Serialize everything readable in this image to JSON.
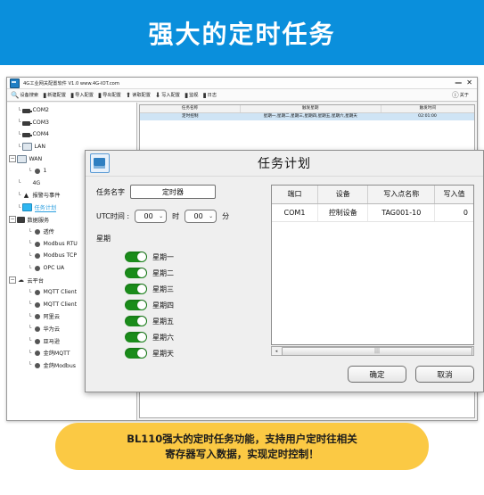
{
  "banner": {
    "title": "强大的定时任务"
  },
  "app": {
    "titlebar": {
      "icon": "app-icon",
      "title": "4G工业网关配置软件 V1.0 www.4G-IOT.com",
      "minimize": "—",
      "close": "✕"
    },
    "toolbar": {
      "buttons": [
        {
          "icon": "search-icon",
          "glyph": "🔍",
          "label": "设备搜索"
        },
        {
          "icon": "new-config-icon",
          "glyph": "▮",
          "label": "新建配置"
        },
        {
          "icon": "import-config-icon",
          "glyph": "▮",
          "label": "导入配置"
        },
        {
          "icon": "export-config-icon",
          "glyph": "▮",
          "label": "导出配置"
        },
        {
          "icon": "read-config-icon",
          "glyph": "⬆",
          "label": "读取配置"
        },
        {
          "icon": "write-config-icon",
          "glyph": "⬇",
          "label": "写入配置"
        },
        {
          "icon": "monitor-icon",
          "glyph": "▮",
          "label": "监视"
        },
        {
          "icon": "log-icon",
          "glyph": "▮",
          "label": "日志"
        }
      ],
      "about": {
        "icon": "about-icon",
        "glyph": "ⓘ",
        "label": "关于"
      }
    },
    "tree": {
      "items": [
        {
          "label": "COM2",
          "depth": 1,
          "icon": "com-port-icon",
          "toggle": "",
          "selected": false
        },
        {
          "label": "COM3",
          "depth": 1,
          "icon": "com-port-icon",
          "toggle": "",
          "selected": false
        },
        {
          "label": "COM4",
          "depth": 1,
          "icon": "com-port-icon",
          "toggle": "",
          "selected": false
        },
        {
          "label": "LAN",
          "depth": 1,
          "icon": "network-icon",
          "toggle": "",
          "selected": false
        },
        {
          "label": "WAN",
          "depth": 0,
          "icon": "network-icon",
          "toggle": "−",
          "selected": false
        },
        {
          "label": "1",
          "depth": 2,
          "icon": "node-icon",
          "toggle": "",
          "selected": false
        },
        {
          "label": "4G",
          "depth": 1,
          "icon": "signal-4g-icon",
          "toggle": "",
          "selected": false
        },
        {
          "label": "报警与事件",
          "depth": 1,
          "icon": "alarm-bell-icon",
          "toggle": "",
          "selected": false
        },
        {
          "label": "任务计划",
          "depth": 1,
          "icon": "task-plan-icon",
          "toggle": "",
          "selected": true
        },
        {
          "label": "数据服务",
          "depth": 0,
          "icon": "server-icon",
          "toggle": "−",
          "selected": false
        },
        {
          "label": "透传",
          "depth": 2,
          "icon": "node-icon",
          "toggle": "",
          "selected": false
        },
        {
          "label": "Modbus RTU",
          "depth": 2,
          "icon": "node-icon",
          "toggle": "",
          "selected": false
        },
        {
          "label": "Modbus TCP",
          "depth": 2,
          "icon": "node-icon",
          "toggle": "",
          "selected": false
        },
        {
          "label": "OPC UA",
          "depth": 2,
          "icon": "node-icon",
          "toggle": "",
          "selected": false
        },
        {
          "label": "云平台",
          "depth": 0,
          "icon": "cloud-icon",
          "toggle": "−",
          "selected": false
        },
        {
          "label": "MQTT Client",
          "depth": 2,
          "icon": "node-icon",
          "toggle": "",
          "selected": false
        },
        {
          "label": "MQTT Client",
          "depth": 2,
          "icon": "node-icon",
          "toggle": "",
          "selected": false
        },
        {
          "label": "阿里云",
          "depth": 2,
          "icon": "node-icon",
          "toggle": "",
          "selected": false
        },
        {
          "label": "华为云",
          "depth": 2,
          "icon": "node-icon",
          "toggle": "",
          "selected": false
        },
        {
          "label": "亚马逊",
          "depth": 2,
          "icon": "node-icon",
          "toggle": "",
          "selected": false
        },
        {
          "label": "金鸽MQTT",
          "depth": 2,
          "icon": "node-icon",
          "toggle": "",
          "selected": false
        },
        {
          "label": "金鸽Modbus",
          "depth": 2,
          "icon": "node-icon",
          "toggle": "",
          "selected": false
        }
      ]
    },
    "task_list": {
      "columns": [
        "任务名称",
        "触发星期",
        "触发时间"
      ],
      "rows": [
        {
          "name": "定时控制",
          "weekdays": "星期一,星期二,星期三,星期四,星期五,星期六,星期天",
          "time": "02:01:00"
        }
      ]
    }
  },
  "dialog": {
    "icon": "task-plan-icon",
    "title": "任务计划",
    "task_name": {
      "label": "任务名字",
      "value": "定时器"
    },
    "utc_time": {
      "label": "UTC时间 :",
      "hour_value": "00",
      "hour_unit": "时",
      "minute_value": "00",
      "minute_unit": "分",
      "chevron": "⌄"
    },
    "week": {
      "label": "星期",
      "days": [
        {
          "label": "星期一",
          "on": true
        },
        {
          "label": "星期二",
          "on": true
        },
        {
          "label": "星期三",
          "on": true
        },
        {
          "label": "星期四",
          "on": true
        },
        {
          "label": "星期五",
          "on": true
        },
        {
          "label": "星期六",
          "on": true
        },
        {
          "label": "星期天",
          "on": true
        }
      ]
    },
    "grid": {
      "columns": [
        "端口",
        "设备",
        "写入点名称",
        "写入值"
      ],
      "rows": [
        {
          "port": "COM1",
          "device": "控制设备",
          "point": "TAG001-10",
          "value": "0"
        }
      ]
    },
    "scrollbar": {
      "left_arrow": "◂",
      "thumb": "|||"
    },
    "buttons": {
      "ok": "确定",
      "cancel": "取消"
    }
  },
  "callout": {
    "line1": "BL110强大的定时任务功能，支持用户定时往相关",
    "line2": "寄存器写入数据，实现定时控制！"
  },
  "colors": {
    "banner_blue": "#0a8fdc",
    "callout_yellow": "#fbc944",
    "toggle_green": "#1a8c1a",
    "selected_row": "#cfe4f5",
    "tree_selected": "#2b9fe0"
  }
}
